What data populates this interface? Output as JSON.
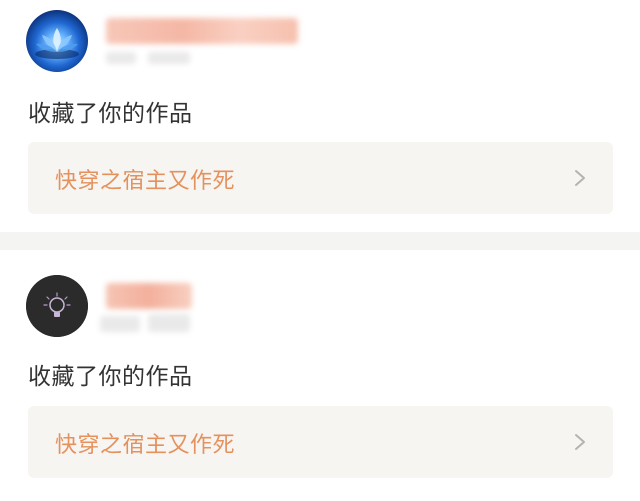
{
  "notifications": [
    {
      "action_text": "收藏了你的作品",
      "work_title": "快穿之宿主又作死",
      "avatar_icon": "lotus-avatar-icon"
    },
    {
      "action_text": "收藏了你的作品",
      "work_title": "快穿之宿主又作死",
      "avatar_icon": "lightbulb-avatar-icon"
    }
  ],
  "colors": {
    "link_text": "#e5915d",
    "body_text": "#333333",
    "card_bg": "#f6f5f2",
    "separator": "#f4f4f2"
  },
  "icons": {
    "link_arrow": "chevron-right-icon"
  }
}
